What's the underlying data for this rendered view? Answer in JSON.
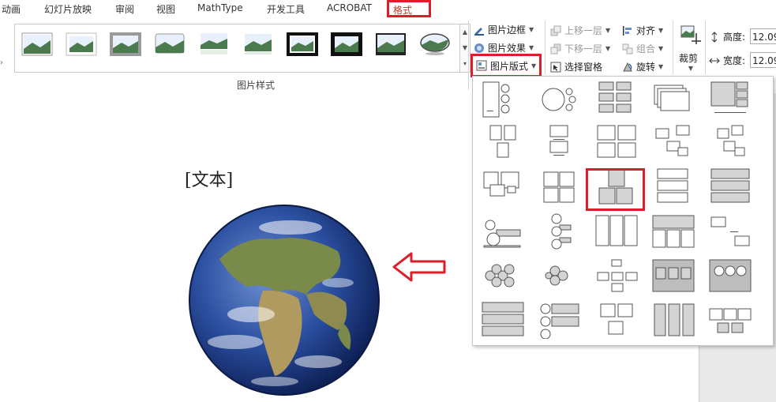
{
  "tabs": [
    {
      "label": "动画"
    },
    {
      "label": "幻灯片放映"
    },
    {
      "label": "审阅"
    },
    {
      "label": "视图"
    },
    {
      "label": "MathType"
    },
    {
      "label": "开发工具"
    },
    {
      "label": "ACROBAT"
    },
    {
      "label": "格式"
    }
  ],
  "ribbon": {
    "group_label": "图片样式",
    "picture_border": "图片边框",
    "picture_effects": "图片效果",
    "picture_layout": "图片版式",
    "bring_forward": "上移一层",
    "send_backward": "下移一层",
    "selection_pane": "选择窗格",
    "align": "对齐",
    "group": "组合",
    "rotate": "旋转",
    "crop": "裁剪",
    "height_label": "高度:",
    "width_label": "宽度:",
    "height_value": "12.09",
    "width_value": "12.09"
  },
  "document": {
    "placeholder": "[文本]"
  },
  "layout_gallery": {
    "rows": 6,
    "columns": 5,
    "selected_row": 2,
    "selected_column": 2
  },
  "colors": {
    "highlight": "#d9202a",
    "accent": "#c0392b"
  },
  "icons": [
    "chevron-down-icon",
    "earth-globe-image",
    "left-arrow-annotation"
  ]
}
